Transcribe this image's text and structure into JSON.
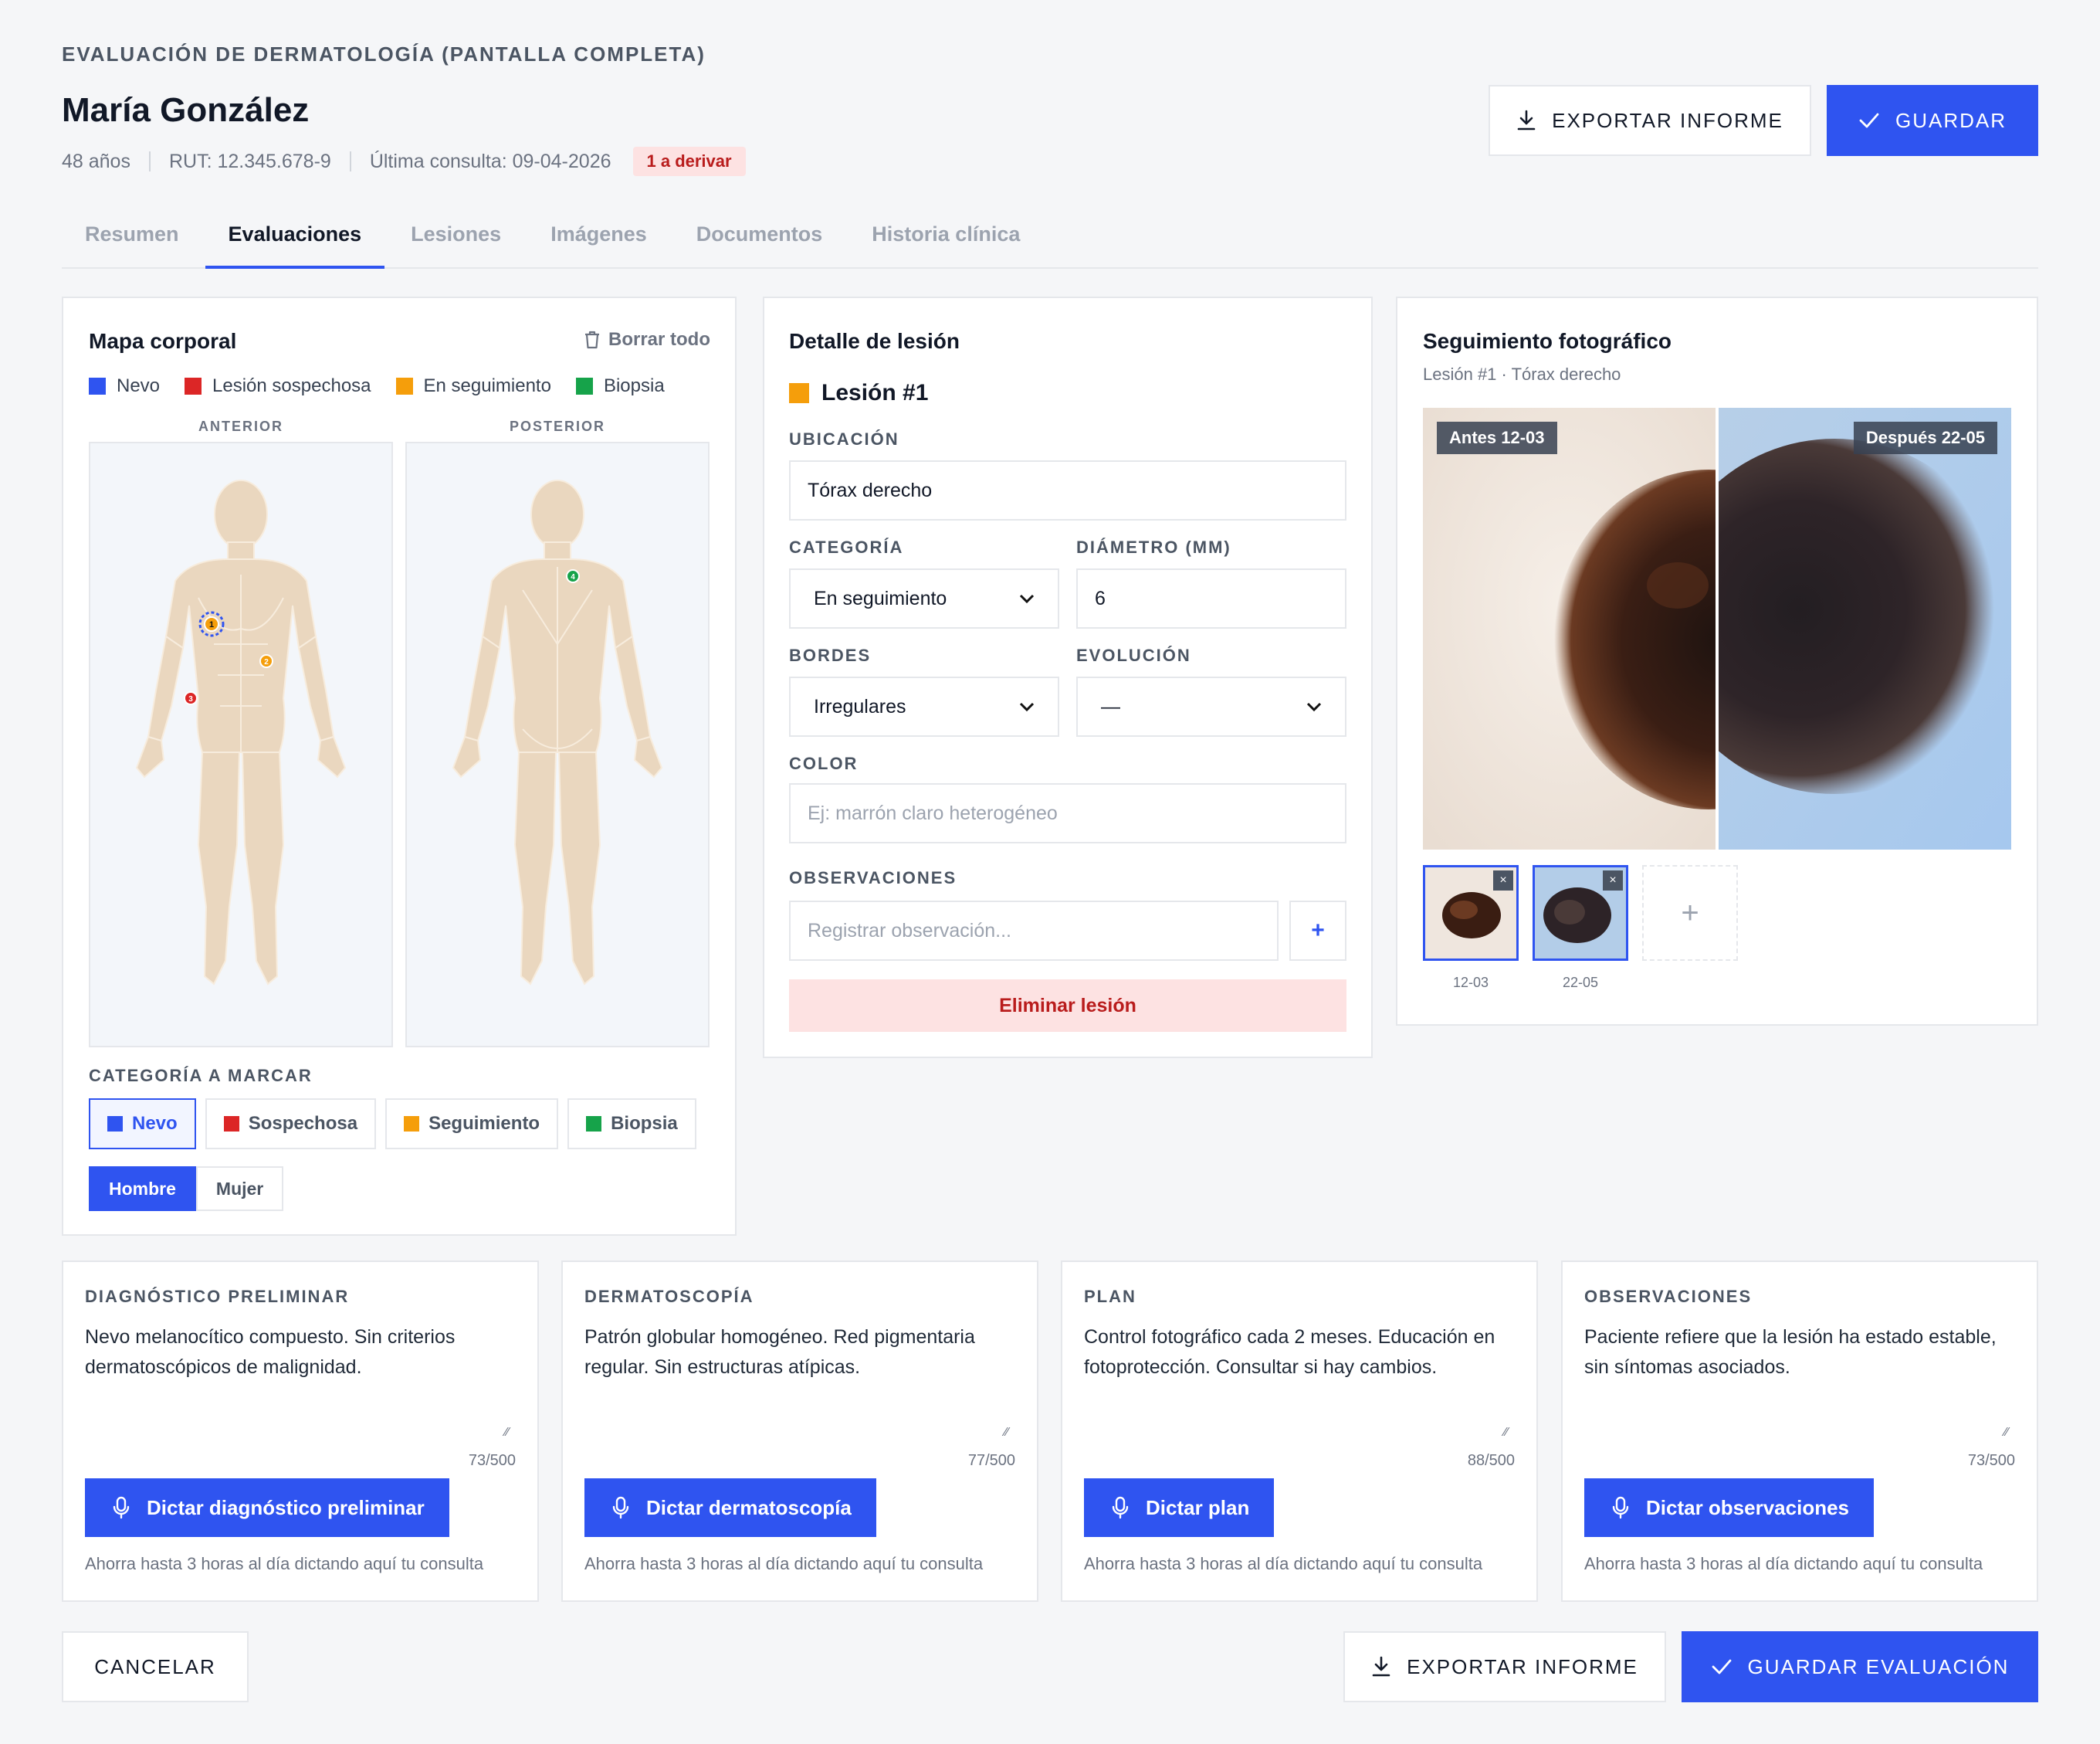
{
  "header": {
    "kicker": "EVALUACIÓN DE DERMATOLOGÍA (PANTALLA COMPLETA)",
    "patient_name": "María González",
    "age": "48 años",
    "rut": "RUT: 12.345.678-9",
    "last_visit": "Última consulta: 09-04-2026",
    "badge": "1 a derivar",
    "export_label": "EXPORTAR INFORME",
    "save_label": "GUARDAR"
  },
  "tabs": [
    {
      "label": "Resumen"
    },
    {
      "label": "Evaluaciones",
      "active": true
    },
    {
      "label": "Lesiones"
    },
    {
      "label": "Imágenes"
    },
    {
      "label": "Documentos"
    },
    {
      "label": "Historia clínica"
    }
  ],
  "body_map": {
    "title": "Mapa corporal",
    "clear_label": "Borrar todo",
    "legend": [
      {
        "label": "Nevo",
        "color": "#2f54f0"
      },
      {
        "label": "Lesión sospechosa",
        "color": "#dc2626"
      },
      {
        "label": "En seguimiento",
        "color": "#f59e0b"
      },
      {
        "label": "Biopsia",
        "color": "#16a34a"
      }
    ],
    "anterior_label": "ANTERIOR",
    "posterior_label": "POSTERIOR",
    "markers": [
      {
        "number": "1",
        "view": "anterior",
        "category": "En seguimiento",
        "selected": true
      },
      {
        "number": "2",
        "view": "anterior",
        "category": "En seguimiento"
      },
      {
        "number": "3",
        "view": "anterior",
        "category": "Lesión sospechosa"
      },
      {
        "number": "4",
        "view": "posterior",
        "category": "Biopsia"
      }
    ],
    "category_label": "CATEGORÍA A MARCAR",
    "categories": [
      {
        "label": "Nevo",
        "color": "#2f54f0",
        "selected": true
      },
      {
        "label": "Sospechosa",
        "color": "#dc2626"
      },
      {
        "label": "Seguimiento",
        "color": "#f59e0b"
      },
      {
        "label": "Biopsia",
        "color": "#16a34a"
      }
    ],
    "sex_options": [
      {
        "label": "Hombre",
        "selected": true
      },
      {
        "label": "Mujer"
      }
    ]
  },
  "detail": {
    "title": "Detalle de lesión",
    "lesion_name": "Lesión #1",
    "lesion_color": "#f59e0b",
    "location_label": "UBICACIÓN",
    "location_value": "Tórax derecho",
    "category_label": "CATEGORÍA",
    "category_value": "En seguimiento",
    "diameter_label": "DIÁMETRO (MM)",
    "diameter_value": "6",
    "borders_label": "BORDES",
    "borders_value": "Irregulares",
    "evolution_label": "EVOLUCIÓN",
    "evolution_value": "—",
    "color_label": "COLOR",
    "color_placeholder": "Ej: marrón claro heterogéneo",
    "obs_label": "OBSERVACIONES",
    "obs_placeholder": "Registrar observación...",
    "add_label": "+",
    "delete_label": "Eliminar lesión"
  },
  "photos": {
    "title": "Seguimiento fotográfico",
    "subtitle": "Lesión #1 · Tórax derecho",
    "before_tag": "Antes 12-03",
    "after_tag": "Después 22-05",
    "thumbs": [
      {
        "date": "12-03",
        "close": "×"
      },
      {
        "date": "22-05",
        "close": "×"
      }
    ],
    "add_label": "+"
  },
  "notes": [
    {
      "label": "DIAGNÓSTICO PRELIMINAR",
      "text": "Nevo melanocítico compuesto. Sin criterios dermatoscópicos de malignidad.",
      "counter": "73/500",
      "button": "Dictar diagnóstico preliminar",
      "hint": "Ahorra hasta 3 horas al día dictando aquí tu consulta"
    },
    {
      "label": "DERMATOSCOPÍA",
      "text": "Patrón globular homogéneo. Red pigmentaria regular. Sin estructuras atípicas.",
      "counter": "77/500",
      "button": "Dictar dermatoscopía",
      "hint": "Ahorra hasta 3 horas al día dictando aquí tu consulta"
    },
    {
      "label": "PLAN",
      "text": "Control fotográfico cada 2 meses. Educación en fotoprotección. Consultar si hay cambios.",
      "counter": "88/500",
      "button": "Dictar plan",
      "hint": "Ahorra hasta 3 horas al día dictando aquí tu consulta"
    },
    {
      "label": "OBSERVACIONES",
      "text": "Paciente refiere que la lesión ha estado estable, sin síntomas asociados.",
      "counter": "73/500",
      "button": "Dictar observaciones",
      "hint": "Ahorra hasta 3 horas al día dictando aquí tu consulta"
    }
  ],
  "footer": {
    "cancel_label": "CANCELAR",
    "export_label": "EXPORTAR INFORME",
    "save_label": "GUARDAR EVALUACIÓN"
  }
}
